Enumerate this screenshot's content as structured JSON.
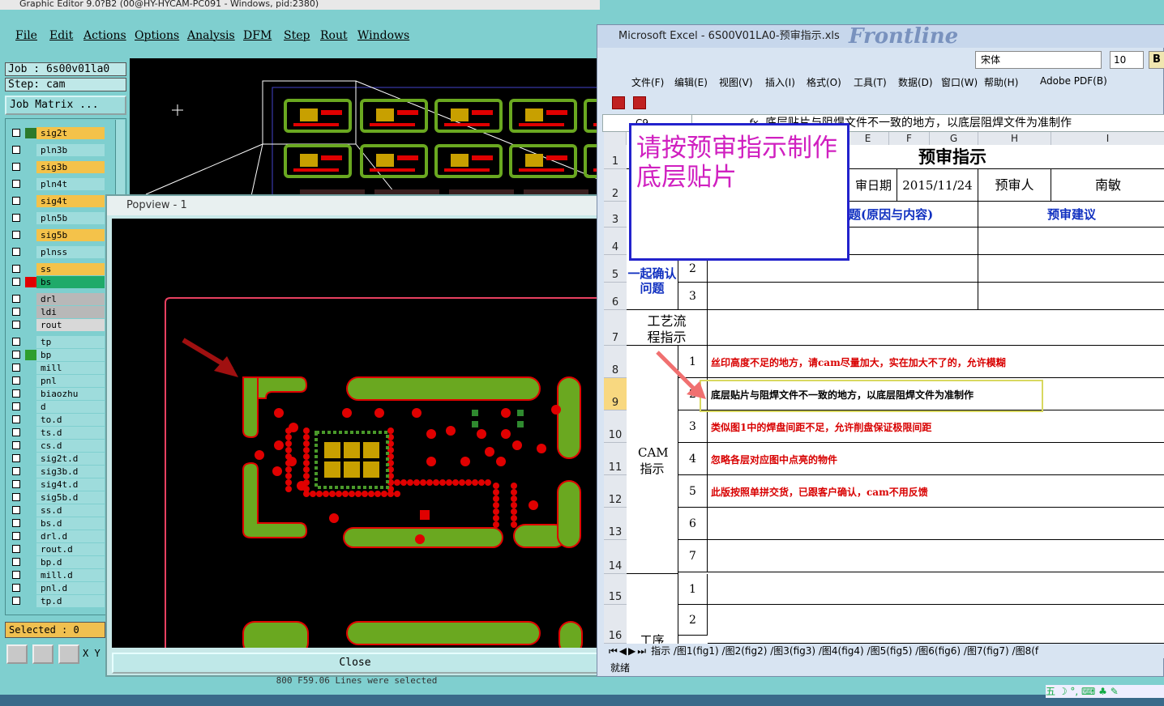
{
  "ge": {
    "title": "Graphic Editor 9.0?B2 (00@HY-HYCAM-PC091 - Windows, pid:2380)",
    "menu": [
      "File",
      "Edit",
      "Actions",
      "Options",
      "Analysis",
      "DFM",
      "Step",
      "Rout",
      "Windows"
    ],
    "job": "Job : 6s00v01la0",
    "step": "Step: cam",
    "job_matrix": "Job Matrix ...",
    "layers": [
      {
        "name": "sig2t",
        "color": "#f4c24a",
        "sw": "#2b7a2b"
      },
      {
        "name": "pln3b",
        "color": "#9edcdc",
        "sw": "#7fcfcf"
      },
      {
        "name": "sig3b",
        "color": "#f4c24a",
        "sw": "#7fcfcf"
      },
      {
        "name": "pln4t",
        "color": "#9edcdc",
        "sw": "#7fcfcf"
      },
      {
        "name": "sig4t",
        "color": "#f4c24a",
        "sw": "#7fcfcf"
      },
      {
        "name": "pln5b",
        "color": "#9edcdc",
        "sw": "#7fcfcf"
      },
      {
        "name": "sig5b",
        "color": "#f4c24a",
        "sw": "#7fcfcf"
      },
      {
        "name": "plnss",
        "color": "#9edcdc",
        "sw": "#7fcfcf"
      },
      {
        "name": "ss",
        "color": "#f4c24a",
        "sw": "#7fcfcf"
      },
      {
        "name": "bs",
        "color": "#1faa6a",
        "sw": "#e00000"
      },
      {
        "name": "drl",
        "color": "#b8b8b8",
        "sw": "#7fcfcf"
      },
      {
        "name": "ldi",
        "color": "#b8b8b8",
        "sw": "#7fcfcf"
      },
      {
        "name": "rout",
        "color": "#d8d8d8",
        "sw": "#7fcfcf"
      },
      {
        "name": "tp",
        "color": "#9edcdc",
        "sw": "#7fcfcf"
      },
      {
        "name": "bp",
        "color": "#9edcdc",
        "sw": "#2e9e2e"
      },
      {
        "name": "mill",
        "color": "#9edcdc",
        "sw": "#7fcfcf"
      },
      {
        "name": "pnl",
        "color": "#9edcdc",
        "sw": "#7fcfcf"
      },
      {
        "name": "biaozhu",
        "color": "#9edcdc",
        "sw": "#7fcfcf"
      },
      {
        "name": "d",
        "color": "#9edcdc",
        "sw": "#7fcfcf"
      },
      {
        "name": "to.d",
        "color": "#9edcdc",
        "sw": "#7fcfcf"
      },
      {
        "name": "ts.d",
        "color": "#9edcdc",
        "sw": "#7fcfcf"
      },
      {
        "name": "cs.d",
        "color": "#9edcdc",
        "sw": "#7fcfcf"
      },
      {
        "name": "sig2t.d",
        "color": "#9edcdc",
        "sw": "#7fcfcf"
      },
      {
        "name": "sig3b.d",
        "color": "#9edcdc",
        "sw": "#7fcfcf"
      },
      {
        "name": "sig4t.d",
        "color": "#9edcdc",
        "sw": "#7fcfcf"
      },
      {
        "name": "sig5b.d",
        "color": "#9edcdc",
        "sw": "#7fcfcf"
      },
      {
        "name": "ss.d",
        "color": "#9edcdc",
        "sw": "#7fcfcf"
      },
      {
        "name": "bs.d",
        "color": "#9edcdc",
        "sw": "#7fcfcf"
      },
      {
        "name": "drl.d",
        "color": "#9edcdc",
        "sw": "#7fcfcf"
      },
      {
        "name": "rout.d",
        "color": "#9edcdc",
        "sw": "#7fcfcf"
      },
      {
        "name": "bp.d",
        "color": "#9edcdc",
        "sw": "#7fcfcf"
      },
      {
        "name": "mill.d",
        "color": "#9edcdc",
        "sw": "#7fcfcf"
      },
      {
        "name": "pnl.d",
        "color": "#9edcdc",
        "sw": "#7fcfcf"
      },
      {
        "name": "tp.d",
        "color": "#9edcdc",
        "sw": "#7fcfcf"
      }
    ],
    "selected": "Selected : 0",
    "xy": "X Y",
    "popview_title": "Popview - 1",
    "close": "Close",
    "status": "800 F59.06 Lines were selected"
  },
  "excel": {
    "title": "Microsoft Excel - 6S00V01LA0-预审指示.xls",
    "watermark": "Frontline",
    "font": "宋体",
    "size": "10",
    "bold": "B",
    "menu": [
      "文件(F)",
      "编辑(E)",
      "视图(V)",
      "插入(I)",
      "格式(O)",
      "工具(T)",
      "数据(D)",
      "窗口(W)",
      "帮助(H)",
      "Adobe PDF(B)"
    ],
    "namebox": "C9",
    "fx": "fx",
    "formula": "底层贴片与阻焊文件不一致的地方，以底层阻焊文件为准制作",
    "cols": [
      "E",
      "F",
      "G",
      "H",
      "I"
    ],
    "rows": [
      "1",
      "2",
      "3",
      "4",
      "5",
      "6",
      "7",
      "8",
      "9",
      "10",
      "11",
      "12",
      "13",
      "14",
      "15",
      "16"
    ],
    "sheet_title": "预审指示",
    "date_label": "审日期",
    "date": "2015/11/24",
    "reviewer_label": "预审人",
    "reviewer": "南敏",
    "problem_header": "题(原因与内容)",
    "advice_header": "预审建议",
    "confirm_label": "一起确认问题",
    "process_label": "工艺流程指示",
    "cam_label": "CAM指示",
    "last_label": "工序",
    "nums": [
      "2",
      "3",
      "1",
      "2",
      "3",
      "4",
      "5",
      "6",
      "7",
      "1",
      "2"
    ],
    "cam_items": [
      "丝印高度不足的地方，请cam尽量加大，实在加大不了的，允许模糊",
      "底层贴片与阻焊文件不一致的地方，以底层阻焊文件为准制作",
      "类似图1中的焊盘间距不足，允许削盘保证极限间距",
      "忽略各层对应图中点亮的物件",
      "此版按照单拼交货，已跟客户确认，cam不用反馈"
    ],
    "tabs": "指示 /图1(fig1) /图2(fig2) /图3(fig3) /图4(fig4) /图5(fig5) /图6(fig6) /图7(fig7) /图8(f",
    "status": "就绪",
    "comment": "请按预审指示制作底层贴片"
  },
  "ime": "五 ☽ °, ⌨ ♣ ✎",
  "colors": {
    "accent_pink": "#d020c0",
    "comment_border": "#2222cc",
    "pcb_green": "#6aa820",
    "pcb_red": "#e00000"
  }
}
